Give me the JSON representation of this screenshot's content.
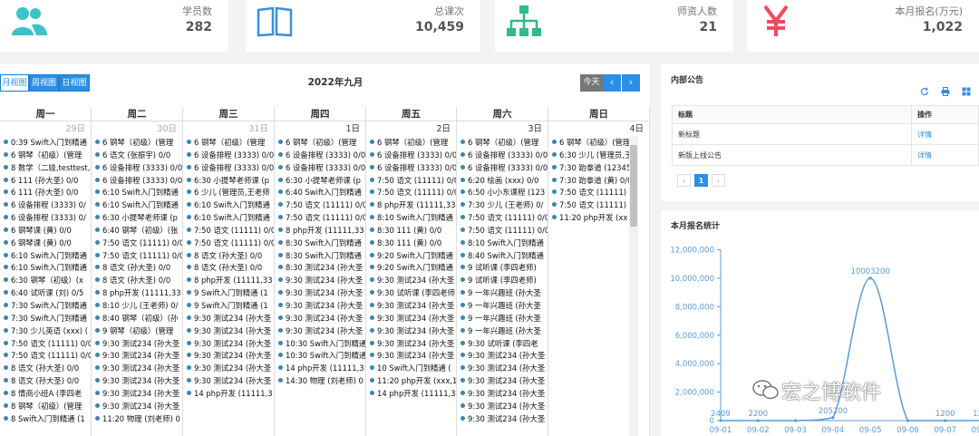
{
  "stats": [
    {
      "label": "学员数",
      "value": "282",
      "icon": "users-icon",
      "color": "#3cc3c7"
    },
    {
      "label": "总课次",
      "value": "10,459",
      "icon": "book-icon",
      "color": "#3a8fd9"
    },
    {
      "label": "师资人数",
      "value": "21",
      "icon": "sitemap-icon",
      "color": "#2fbb8e"
    },
    {
      "label": "本月报名(万元)",
      "value": "1,022",
      "icon": "yen-icon",
      "color": "#ec4c5c"
    }
  ],
  "calendar": {
    "views": [
      "月视图",
      "周视图",
      "日视图"
    ],
    "title": "2022年九月",
    "today": "今天",
    "prev": "‹",
    "next": "›",
    "days": [
      "周一",
      "周二",
      "周三",
      "周四",
      "周五",
      "周六",
      "周日"
    ],
    "columns": [
      {
        "date": "29日",
        "old": true,
        "events": [
          "0:39 Swift入门到精通",
          "6 钢琴（初级）(管理",
          "8 数学（二娃,testtest,",
          "6 111 (孙大圣) 0/0",
          "6 111 (孙大圣) 0/0",
          "6 设备排程 (3333) 0/",
          "6 设备排程 (3333) 0/",
          "6 钢琴课 (黄) 0/0",
          "6 钢琴课 (黄) 0/0",
          "6:10 Swift入门到精通",
          "6:10 Swift入门到精通",
          "6:30 钢琴（初级）(x",
          "6:40 试听课 (刘) 0/5",
          "7:30 Swift入门到精通",
          "7:30 Swift入门到精通",
          "7:30 少儿英语 (xxx) (",
          "7:50 语文 (11111) 0/0",
          "7:50 语文 (11111) 0/0",
          "8 语文 (孙大圣) 0/0",
          "8 语文 (孙大圣) 0/0",
          "8 情商小班A (李四老",
          "8 钢琴（初级）(管理",
          "8 Swift入门到精通 (1"
        ]
      },
      {
        "date": "30日",
        "old": true,
        "events": [
          "6 钢琴（初级）(管理",
          "6 语文 (张振宇) 0/0",
          "6 设备排程 (3333) 0/0",
          "6 设备排程 (3333) 0/0",
          "6:10 Swift入门到精通",
          "6:10 Swift入门到精通",
          "6:30 小提琴老师课 (p",
          "6:40 钢琴（初级）(张",
          "7:50 语文 (11111) 0/0",
          "7:50 语文 (11111) 0/0",
          "8 语文 (孙大圣) 0/0",
          "8 语文 (孙大圣) 0/0",
          "8 php开发 (11111,33",
          "8:10 少儿 (王老师) 0/",
          "8:40 钢琴（初级）(孙",
          "9 钢琴（初级）(管理",
          "9:30 测试234 (孙大圣",
          "9:30 测试234 (孙大圣",
          "9:30 测试234 (孙大圣",
          "9:30 测试234 (孙大圣",
          "9:30 测试234 (孙大圣",
          "9:30 测试234 (孙大圣",
          "11:20 物理 (刘老师) 0"
        ]
      },
      {
        "date": "31日",
        "old": true,
        "events": [
          "6 钢琴（初级）(管理",
          "6 设备排程 (3333) 0/0",
          "6 设备排程 (3333) 0/0",
          "6:30 小提琴老师课 (p",
          "6 少儿 (管理员,王老师",
          "6:10 Swift入门到精通",
          "6:10 Swift入门到精通",
          "7:50 语文 (11111) 0/0",
          "7:50 语文 (11111) 0/0",
          "8 语文 (孙大圣) 0/0",
          "8 语文 (孙大圣) 0/0",
          "8 php开发 (11111,33",
          "9 Swift入门到精通 (1",
          "9 Swift入门到精通 (1",
          "9:30 测试234 (孙大圣",
          "9:30 测试234 (孙大圣",
          "9:30 测试234 (孙大圣",
          "9:30 测试234 (孙大圣",
          "9:30 测试234 (孙大圣",
          "9:30 测试234 (孙大圣",
          "14 php开发 (11111,3"
        ]
      },
      {
        "date": "1日",
        "old": false,
        "events": [
          "6 钢琴（初级）(管理",
          "6 设备排程 (3333) 0/0",
          "6 设备排程 (3333) 0/0",
          "6:30 小提琴老师课 (p",
          "6:40 Swift入门到精通",
          "7:50 语文 (11111) 0/0",
          "7:50 语文 (11111) 0/0",
          "8 php开发 (11111,33",
          "8:30 Swift入门到精通",
          "8:30 Swift入门到精通",
          "8:30 测试234 (孙大圣",
          "9:30 测试234 (孙大圣",
          "9:30 测试234 (孙大圣",
          "9:30 测试234 (孙大圣",
          "9:30 测试234 (孙大圣",
          "9:30 测试234 (孙大圣",
          "10:30 Swift入门到精通",
          "10:30 Swift入门到精通",
          "14 php开发 (11111,3",
          "14:30 物理 (刘老师) 0"
        ]
      },
      {
        "date": "2日",
        "old": false,
        "events": [
          "6 钢琴（初级）(管理",
          "6 设备排程 (3333) 0/0",
          "6 设备排程 (3333) 0/0",
          "7:50 语文 (11111) 0/0",
          "7:50 语文 (11111) 0/0",
          "8 php开发 (11111,33",
          "8:10 Swift入门到精通",
          "8:30 111 (黄) 0/0",
          "8:30 111 (黄) 0/0",
          "9:20 Swift入门到精通",
          "9:20 Swift入门到精通",
          "9:30 测试234 (孙大圣",
          "9:30 试听课 (李四老师",
          "9:30 测试234 (孙大圣",
          "9:30 测试234 (孙大圣",
          "9:30 测试234 (孙大圣",
          "9:30 测试234 (孙大圣",
          "9:30 测试234 (孙大圣",
          "10 Swift入门到精通 (",
          "11:20 php开发 (xxx,1",
          "14 php开发 (11111,3"
        ]
      },
      {
        "date": "3日",
        "old": false,
        "events": [
          "6 钢琴（初级）(管理",
          "6 设备排程 (3333) 0/0",
          "6 设备排程 (3333) 0/0",
          "6:20 绘画 (xxx) 0/0",
          "6:50 小小东课程 (123",
          "7:30 少儿 (王老师) 0/",
          "7:50 语文 (11111) 0/0",
          "7:50 语文 (11111) 0/0",
          "8:10 Swift入门到精通",
          "8:40 Swift入门到精通",
          "9 试听课 (李四老师)",
          "9 试听课 (李四老师)",
          "9 一年兴趣班 (孙大圣",
          "9 一年兴趣班 (孙大圣",
          "9 一年兴趣班 (孙大圣",
          "9 一年兴趣班 (孙大圣",
          "9:30 试听课 (李四老",
          "9:30 测试234 (孙大圣",
          "9:30 测试234 (孙大圣",
          "9:30 测试234 (孙大圣",
          "9:30 测试234 (孙大圣",
          "9:30 测试234 (孙大圣",
          "9:30 测试234 (孙大圣"
        ]
      },
      {
        "date": "4日",
        "old": false,
        "events": [
          "6 钢琴（初级）(管理",
          "6:30 少儿 (管理员,王",
          "7:30 跆拳道 (12345",
          "7:30 跆拳道 (黄) 0/0",
          "7:50 语文 (11111) 0/",
          "7:50 语文 (11111) 0/",
          "11:20 php开发 (xx"
        ]
      }
    ]
  },
  "notice": {
    "title": "内部公告",
    "tools": [
      "refresh-icon",
      "print-icon",
      "grid-icon"
    ],
    "headers": [
      "标题",
      "操作"
    ],
    "rows": [
      {
        "title": "新标题",
        "action": "详情"
      },
      {
        "title": "新版上线公告",
        "action": "详情"
      }
    ],
    "pager": [
      "‹",
      "1",
      "›"
    ]
  },
  "stat": {
    "title": "本月报名统计"
  },
  "chart_data": {
    "type": "line",
    "title": "本月报名统计",
    "x": [
      "09-01",
      "09-02",
      "09-03",
      "09-04",
      "09-05",
      "09-06",
      "09-07",
      "09-08"
    ],
    "values": [
      2409,
      2200,
      0,
      205200,
      10003200,
      0,
      1200,
      1200
    ],
    "data_labels": [
      "2409",
      "2200",
      "",
      "205200",
      "10003200",
      "",
      "1200",
      "1200"
    ],
    "yticks": [
      "12,000,000",
      "10,000,000",
      "8,000,000",
      "6,000,000",
      "4,000,000",
      "2,000,000",
      "0"
    ],
    "ylim": [
      0,
      12000000
    ],
    "color": "#5b9bd5"
  },
  "watermark": "宏之博软件"
}
